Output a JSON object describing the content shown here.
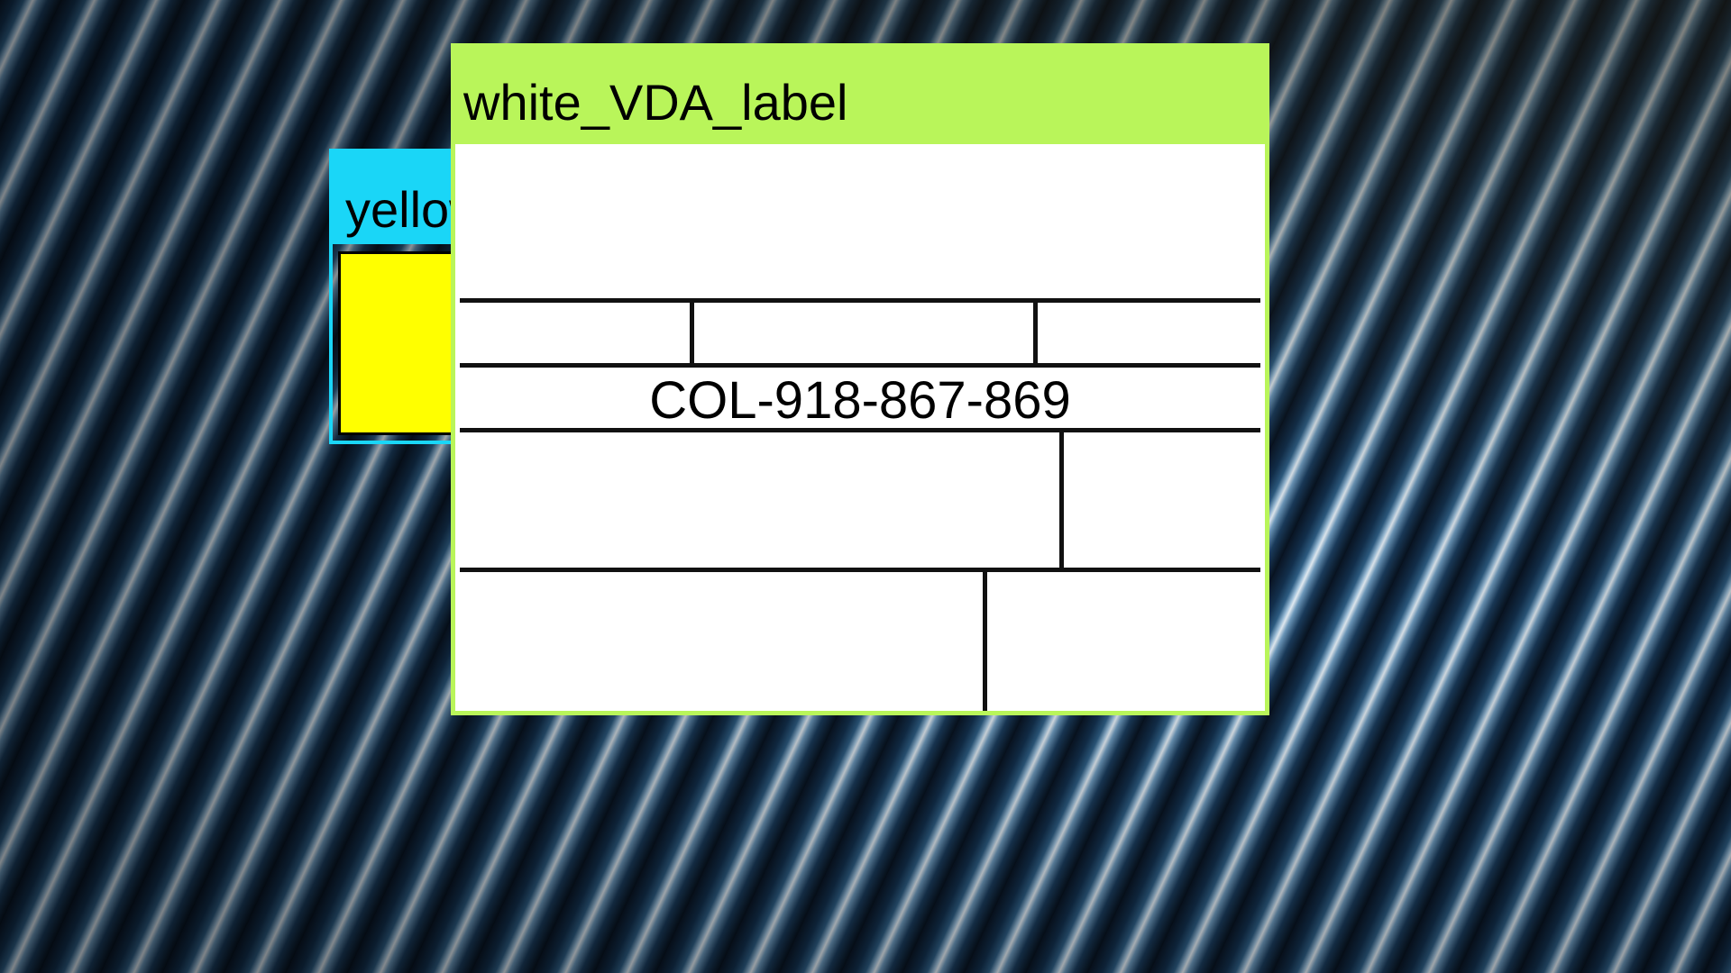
{
  "boxes": {
    "yellow": {
      "title": "yellow_VDA_label"
    },
    "white": {
      "title": "white_VDA_label"
    }
  },
  "label": {
    "code": "COL-918-867-869"
  },
  "colors": {
    "white_box_border": "#b9f55a",
    "yellow_box_border": "#1ad6f7",
    "yellow_fill": "#ffff00"
  }
}
